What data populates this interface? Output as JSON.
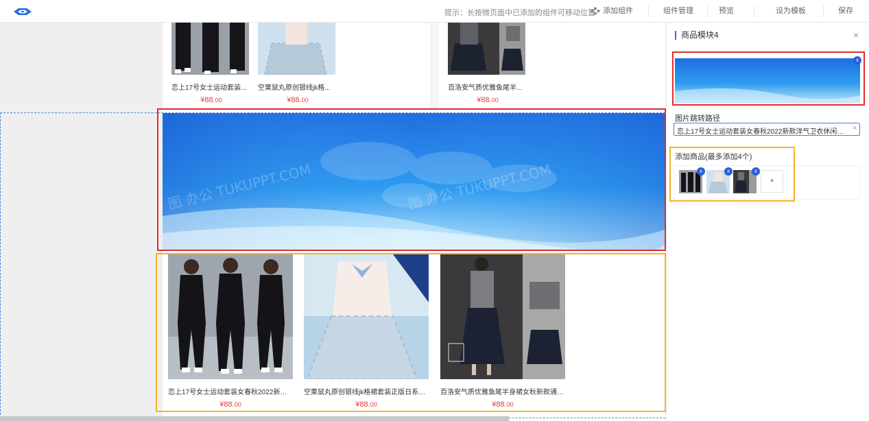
{
  "topbar": {
    "hint": "提示：长按微页面中已添加的组件可移动位置",
    "add_component": "添加组件",
    "manage_components": "组件管理",
    "preview": "预览",
    "set_template": "设为模板",
    "save": "保存"
  },
  "canvas": {
    "top_products": [
      {
        "name": "恋上17号女士运动套装...",
        "price_main": "¥88.",
        "price_decimal": "00"
      },
      {
        "name": "空栗鼠丸原创银线jk格...",
        "price_main": "¥88.",
        "price_decimal": "00"
      },
      {
        "name": "百洛安气质优雅鱼尾半...",
        "price_main": "¥88.",
        "price_decimal": "00"
      }
    ],
    "banner_watermark": "图 办公 TUKUPPT.COM",
    "bottom_products": [
      {
        "name": "恋上17号女士运动套装女春秋2022新款洋...",
        "price_main": "¥88.",
        "price_decimal": "00"
      },
      {
        "name": "空栗鼠丸原创银线jk格裙套装正版日系学院...",
        "price_main": "¥88.",
        "price_decimal": "00"
      },
      {
        "name": "百洛安气质优雅鱼尾半身裙女秋新款通勤...",
        "price_main": "¥88.",
        "price_decimal": "00"
      }
    ]
  },
  "panel": {
    "title": "商品模块4",
    "close": "×",
    "remove_badge": "x",
    "image_path_label": "图片跳转路径",
    "image_path_value": "恋上17号女士运动套装女春秋2022新款洋气卫衣休闲服秋...",
    "clear": "×",
    "add_goods_label": "添加商品(最多添加4个)",
    "add_button": "+"
  },
  "colors": {
    "accent": "#2d6bd8",
    "selection_red": "#e42a2a",
    "selection_yellow": "#f5b324",
    "price": "#e83a3a"
  }
}
